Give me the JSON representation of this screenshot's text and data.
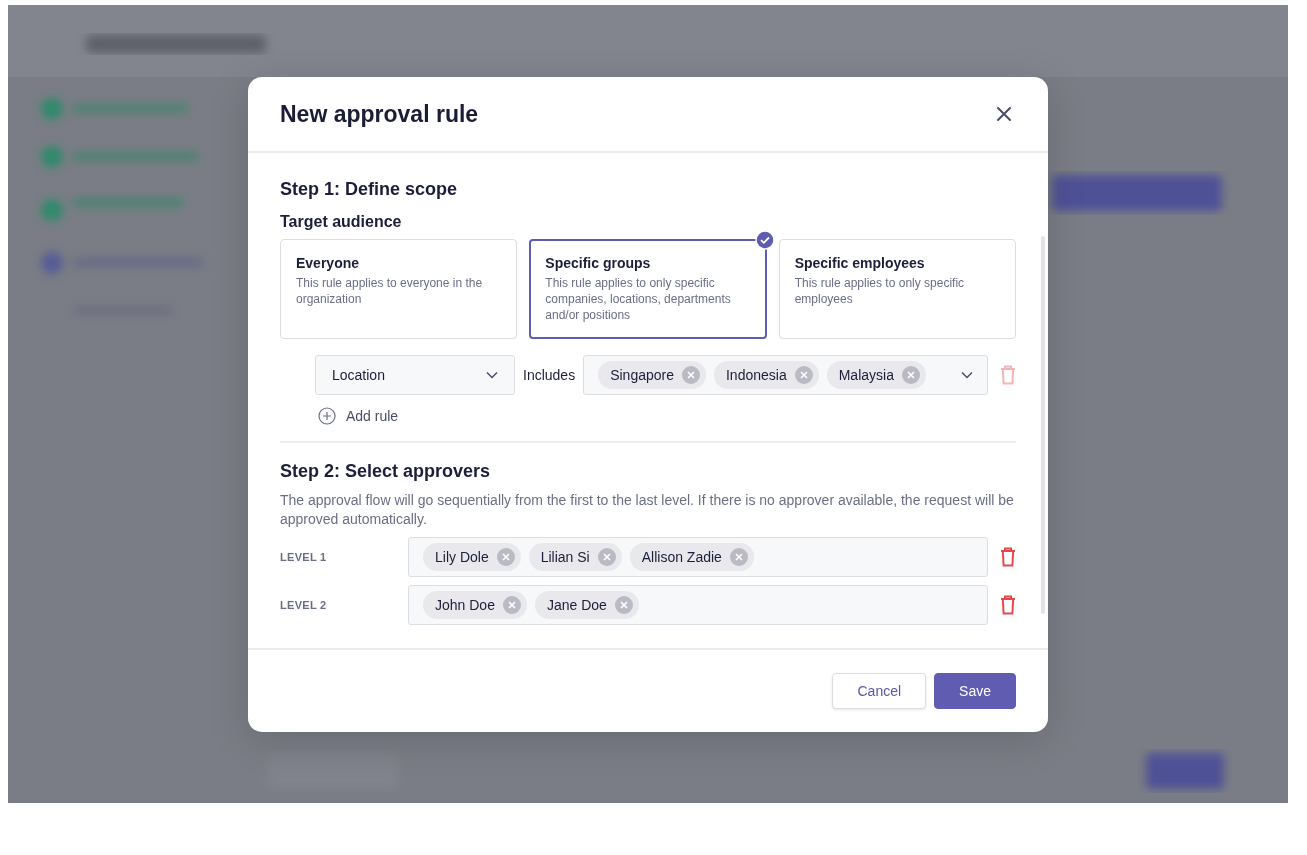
{
  "dialog": {
    "title": "New approval rule"
  },
  "step1": {
    "heading": "Step 1: Define scope",
    "subheading": "Target audience",
    "options": [
      {
        "title": "Everyone",
        "description": "This rule applies to everyone in the organization",
        "selected": false
      },
      {
        "title": "Specific groups",
        "description": "This rule applies to only specific companies, locations, departments and/or positions",
        "selected": true
      },
      {
        "title": "Specific employees",
        "description": "This rule applies to only specific employees",
        "selected": false
      }
    ],
    "rules": [
      {
        "field": "Location",
        "operator": "Includes",
        "values": [
          "Singapore",
          "Indonesia",
          "Malaysia"
        ],
        "delete_disabled": true
      }
    ],
    "add_rule": "Add rule"
  },
  "step2": {
    "heading": "Step 2: Select approvers",
    "description": "The approval flow will go sequentially from the first to the last level. If there is no approver available, the request will be approved automatically.",
    "levels": [
      {
        "label": "LEVEL 1",
        "approvers": [
          "Lily Dole",
          "Lilian Si",
          "Allison Zadie"
        ],
        "delete_disabled": false
      },
      {
        "label": "LEVEL 2",
        "approvers": [
          "John Doe",
          "Jane Doe"
        ],
        "delete_disabled": false
      }
    ]
  },
  "buttons": [
    {
      "label": "Cancel",
      "kind": "secondary"
    },
    {
      "label": "Save",
      "kind": "primary"
    }
  ]
}
